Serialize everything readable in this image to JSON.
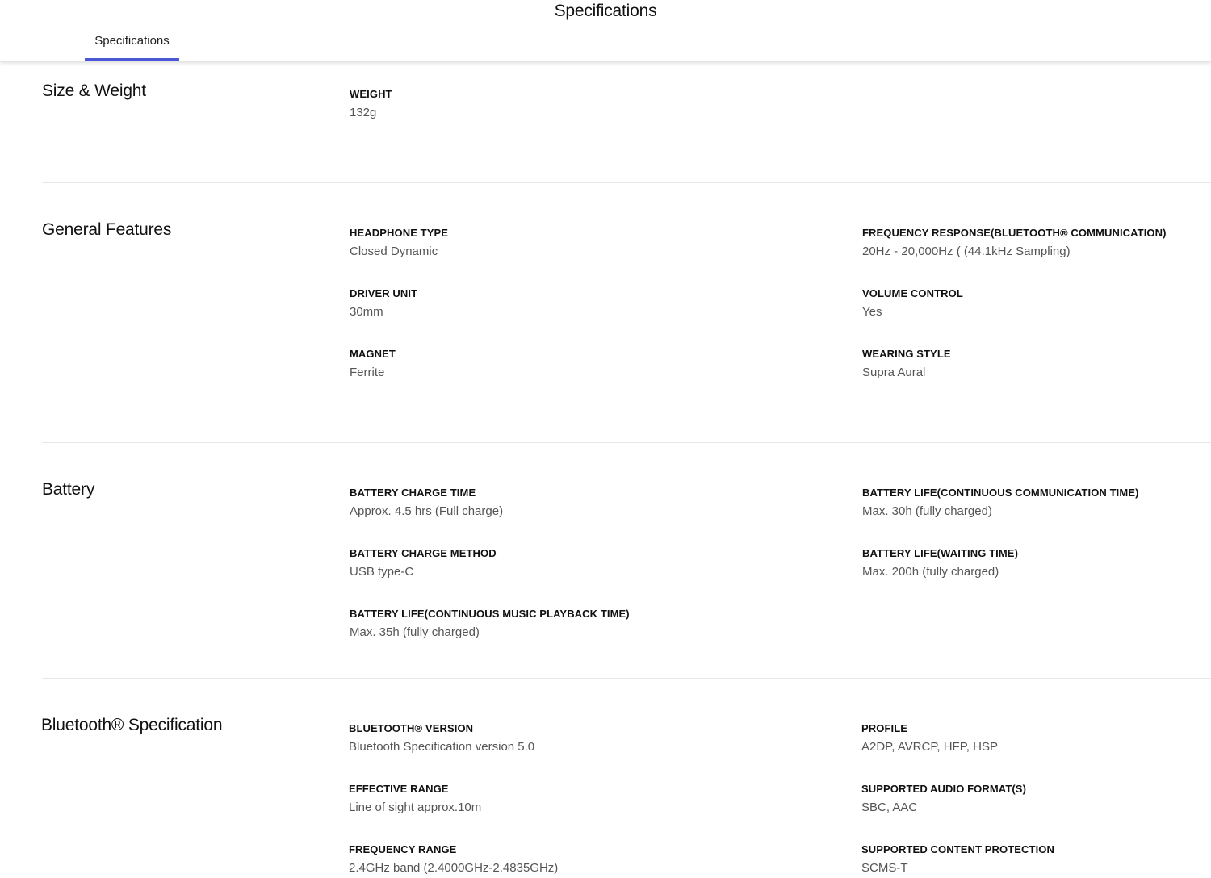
{
  "header": {
    "title": "Specifications",
    "tab_label": "Specifications",
    "accent_color": "#4a57d6"
  },
  "sections": [
    {
      "title": "Size & Weight",
      "specs": [
        {
          "label": "WEIGHT",
          "value": "132g"
        }
      ]
    },
    {
      "title": "General Features",
      "specs": [
        {
          "label": "HEADPHONE TYPE",
          "value": "Closed Dynamic"
        },
        {
          "label": "DRIVER UNIT",
          "value": "30mm"
        },
        {
          "label": "MAGNET",
          "value": "Ferrite"
        },
        {
          "label": "FREQUENCY RESPONSE(BLUETOOTH® COMMUNICATION)",
          "value": "20Hz - 20,000Hz ( (44.1kHz Sampling)"
        },
        {
          "label": "VOLUME CONTROL",
          "value": "Yes"
        },
        {
          "label": "WEARING STYLE",
          "value": "Supra Aural"
        }
      ]
    },
    {
      "title": "Battery",
      "specs": [
        {
          "label": "BATTERY CHARGE TIME",
          "value": "Approx. 4.5 hrs (Full charge)"
        },
        {
          "label": "BATTERY CHARGE METHOD",
          "value": "USB type-C"
        },
        {
          "label": "BATTERY LIFE(CONTINUOUS MUSIC PLAYBACK TIME)",
          "value": "Max. 35h (fully charged)"
        },
        {
          "label": "BATTERY LIFE(CONTINUOUS COMMUNICATION TIME)",
          "value": "Max. 30h (fully charged)"
        },
        {
          "label": "BATTERY LIFE(WAITING TIME)",
          "value": "Max. 200h (fully charged)"
        }
      ]
    },
    {
      "title": "Bluetooth® Specification",
      "specs": [
        {
          "label": "BLUETOOTH® VERSION",
          "value": "Bluetooth Specification version 5.0"
        },
        {
          "label": "EFFECTIVE RANGE",
          "value": "Line of sight approx.10m"
        },
        {
          "label": "FREQUENCY RANGE",
          "value": "2.4GHz band (2.4000GHz-2.4835GHz)"
        },
        {
          "label": "PROFILE",
          "value": "A2DP, AVRCP, HFP, HSP"
        },
        {
          "label": "SUPPORTED AUDIO FORMAT(S)",
          "value": "SBC, AAC"
        },
        {
          "label": "SUPPORTED CONTENT PROTECTION",
          "value": "SCMS-T"
        }
      ]
    }
  ]
}
